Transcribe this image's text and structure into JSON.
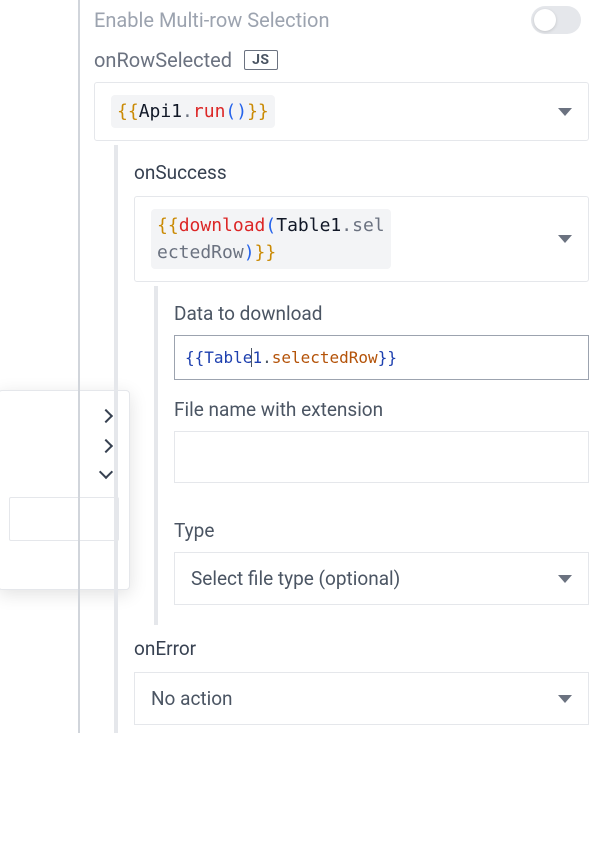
{
  "settings": {
    "multirow_label": "Enable Multi-row Selection",
    "multirow_enabled": false
  },
  "event": {
    "label": "onRowSelected",
    "js_badge": "JS"
  },
  "action": {
    "code": {
      "open": "{{",
      "obj": "Api1",
      "dot": ".",
      "method": "run",
      "paren_open": "(",
      "paren_close": ")",
      "close": "}}"
    }
  },
  "onSuccess": {
    "label": "onSuccess",
    "action_code": {
      "open": "{{",
      "fn": "download",
      "paren_open": "(",
      "obj": "Table1",
      "dot": ".",
      "member_a": "sel",
      "member_b": "ectedRow",
      "paren_close": ")",
      "close": "}}"
    },
    "fields": {
      "data_label": "Data to download",
      "data_value": {
        "open": "{{",
        "obj_a": "Table",
        "obj_b": "1",
        "dot": ".",
        "member": "selectedRow",
        "close": "}}"
      },
      "filename_label": "File name with extension",
      "filename_value": "",
      "type_label": "Type",
      "type_placeholder": "Select file type (optional)"
    }
  },
  "onError": {
    "label": "onError",
    "value": "No action"
  }
}
